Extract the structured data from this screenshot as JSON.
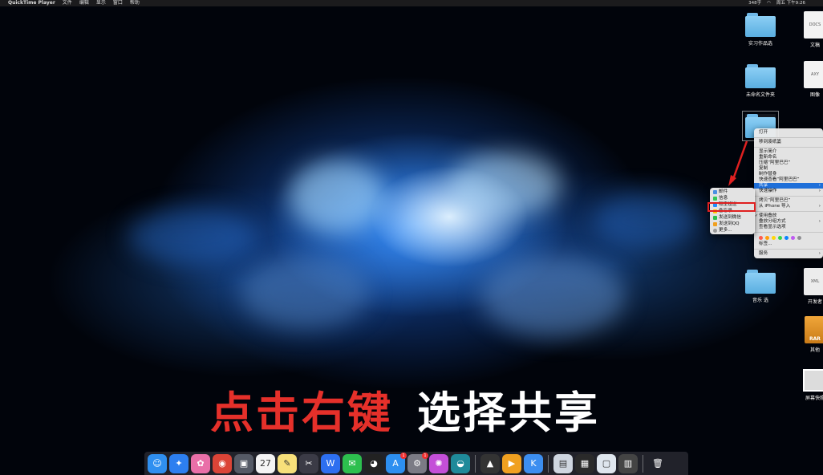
{
  "menubar": {
    "apple": "",
    "app_name": "QuickTime Player",
    "menus": [
      "文件",
      "编辑",
      "显示",
      "窗口",
      "帮助"
    ],
    "status": [
      "348字",
      "周五 下午9:26"
    ]
  },
  "desktop_icons": [
    {
      "label": "实习作品选",
      "kind": "folder"
    },
    {
      "label": "未命名文件夹",
      "kind": "folder"
    },
    {
      "label": "",
      "kind": "folder"
    },
    {
      "label": "音乐 选",
      "kind": "folder"
    },
    {
      "label": "文稿",
      "kind": "doc",
      "glyph": "DOCS"
    },
    {
      "label": "图像",
      "kind": "doc",
      "glyph": "AXY"
    },
    {
      "label": "开发者",
      "kind": "doc",
      "glyph": "XML"
    },
    {
      "label": "其他",
      "kind": "rar",
      "glyph": "RAR"
    },
    {
      "label": "屏幕快照",
      "kind": "shot"
    }
  ],
  "context_menu": {
    "items": [
      "打开",
      "移到废纸篓",
      "显示简介",
      "重新命名",
      "压缩“阿里巴巴”",
      "复制",
      "制作替身",
      "快速查看“阿里巴巴”",
      "共享",
      "快速操作",
      "拷贝“阿里巴巴”",
      "从 iPhone 导入",
      "使用叠放",
      "叠放分组方式",
      "查看显示选项",
      "标签...",
      "服务"
    ],
    "highlighted": "共享",
    "tag_colors": [
      "#ff5b4f",
      "#ff9f0a",
      "#ffd60a",
      "#32d74b",
      "#0a84ff",
      "#bf5af2",
      "#8e8e93"
    ]
  },
  "share_submenu": {
    "items": [
      "邮件",
      "信息",
      "隔空投送",
      "备忘录",
      "发送到微信",
      "发送到QQ",
      "更多..."
    ],
    "highlighted": "隔空投送"
  },
  "caption": {
    "part1": "点击右键",
    "part2": "选择共享"
  },
  "dock": {
    "apps": [
      {
        "name": "finder-icon",
        "glyph": "☺",
        "bg": "#2f8ff0"
      },
      {
        "name": "safari-icon",
        "glyph": "✦",
        "bg": "#2d7ff0"
      },
      {
        "name": "photos-icon",
        "glyph": "✿",
        "bg": "#e96fa8"
      },
      {
        "name": "chrome-icon",
        "glyph": "◉",
        "bg": "#db4437"
      },
      {
        "name": "photo-booth-icon",
        "glyph": "▣",
        "bg": "#555a66"
      },
      {
        "name": "calendar-icon",
        "glyph": "27",
        "bg": "#f4f4f4"
      },
      {
        "name": "notes-icon",
        "glyph": "✎",
        "bg": "#f7e07a"
      },
      {
        "name": "final-cut-icon",
        "glyph": "✂",
        "bg": "#3b3b46"
      },
      {
        "name": "wps-icon",
        "glyph": "W",
        "bg": "#2d6ff0"
      },
      {
        "name": "wechat-icon",
        "glyph": "✉",
        "bg": "#2dbf4e"
      },
      {
        "name": "qq-icon",
        "glyph": "◕",
        "bg": "#222222"
      },
      {
        "name": "app-store-icon",
        "glyph": "A",
        "bg": "#2d8ff0",
        "badge": "1"
      },
      {
        "name": "system-preferences-icon",
        "glyph": "⚙",
        "bg": "#7b7b85",
        "badge": "1"
      },
      {
        "name": "flower-app-icon",
        "glyph": "✺",
        "bg": "#c44fd8"
      },
      {
        "name": "edge-icon",
        "glyph": "◒",
        "bg": "#1f8a9a"
      },
      {
        "name": "inkscape-icon",
        "glyph": "▲",
        "bg": "#333333"
      },
      {
        "name": "infuse-icon",
        "glyph": "▶",
        "bg": "#f0a020"
      },
      {
        "name": "k-app-icon",
        "glyph": "K",
        "bg": "#3c8ef0"
      },
      {
        "name": "downloads-stack-icon",
        "glyph": "▤",
        "bg": "#cfd6e0"
      },
      {
        "name": "keyboard-stack-icon",
        "glyph": "▦",
        "bg": "#2a2a2a"
      },
      {
        "name": "screen-stack-icon",
        "glyph": "▢",
        "bg": "#dfe6ee"
      },
      {
        "name": "screenshot-stack-icon",
        "glyph": "▥",
        "bg": "#444444"
      },
      {
        "name": "trash-icon",
        "glyph": "🗑",
        "bg": "transparent"
      }
    ]
  }
}
